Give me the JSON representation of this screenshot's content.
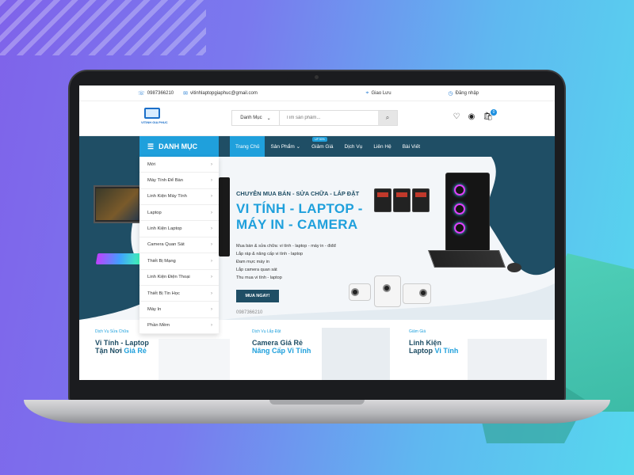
{
  "topbar": {
    "phone": "0987366210",
    "email": "vitinhlaptopgiaphuc@gmail.com",
    "address": "Giao Lưu",
    "login": "Đăng nhập"
  },
  "header": {
    "logo_text": "VITINH GIA PHUC",
    "category_select": "Danh Mục",
    "search_placeholder": "Tìm sản phẩm...",
    "cart_count": "0"
  },
  "nav": {
    "danh_muc": "DANH MỤC",
    "items": [
      {
        "label": "Trang Chủ"
      },
      {
        "label": "Sản Phẩm"
      },
      {
        "label": "Giảm Giá"
      },
      {
        "label": "Dịch Vụ"
      },
      {
        "label": "Liên Hệ"
      },
      {
        "label": "Bài Viết"
      }
    ],
    "badge": "UP 50%"
  },
  "side_menu": {
    "items": [
      {
        "label": "Mới"
      },
      {
        "label": "Máy Tính Để Bàn"
      },
      {
        "label": "Linh Kiện Máy Tính"
      },
      {
        "label": "Laptop"
      },
      {
        "label": "Linh Kiện Laptop"
      },
      {
        "label": "Camera Quan Sát"
      },
      {
        "label": "Thiết Bị Mạng"
      },
      {
        "label": "Linh Kiện Điện Thoại"
      },
      {
        "label": "Thiết Bị Tin Học"
      },
      {
        "label": "Máy In"
      },
      {
        "label": "Phần Mềm"
      }
    ]
  },
  "hero": {
    "subtitle": "CHUYÊN MUA BÁN - SỬA CHỮA - LẮP ĐẶT",
    "title_line1": "VI TÍNH - LAPTOP -",
    "title_line2": "MÁY IN - CAMERA",
    "list": [
      "Mua bán & sửa chữa: vi tính - laptop - máy in - điđđ",
      "Lắp ráp & nâng cấp vi tính - laptop",
      "Đam mực máy in",
      "Lắp camera quan sát",
      "Thu mua vi tính - laptop"
    ],
    "button": "MUA NGAY!",
    "phone": "0987366210"
  },
  "promos": [
    {
      "tag": "Dịch Vụ Sửa Chữa",
      "title": "Vi Tính - Laptop",
      "title2": "Tận Nơi",
      "highlight": "Giá Rẻ"
    },
    {
      "tag": "Dịch Vụ Lắp Đặt",
      "title": "Camera Giá Rẻ",
      "title2": "",
      "highlight": "Nâng Cấp Vi Tính"
    },
    {
      "tag": "Giảm Giá",
      "title": "Linh Kiện",
      "title2": "Laptop",
      "highlight": "Vi Tính"
    }
  ],
  "icons": {
    "phone": "phone-icon",
    "email": "email-icon",
    "location": "location-icon",
    "login": "clock-icon",
    "search": "search-icon",
    "heart": "heart-icon",
    "user": "user-icon",
    "cart": "cart-icon",
    "menu": "hamburger-icon"
  },
  "colors": {
    "primary": "#1fa0dc",
    "dark": "#1f4e65"
  }
}
